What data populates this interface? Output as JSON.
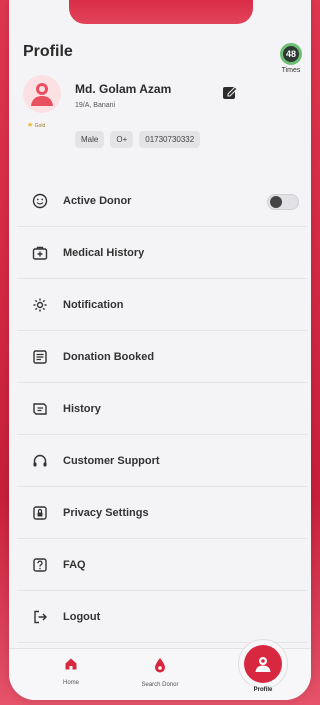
{
  "header": {
    "title": "Profile",
    "times_count": "48",
    "times_label": "Times"
  },
  "profile": {
    "name": "Md. Golam Azam",
    "address": "19/A, Banani",
    "badge": "Gold",
    "gender": "Male",
    "blood_group": "O+",
    "phone": "01730730332"
  },
  "menu": [
    {
      "label": "Active Donor",
      "icon": "smile-icon"
    },
    {
      "label": "Medical History",
      "icon": "medical-kit-icon"
    },
    {
      "label": "Notification",
      "icon": "gear-icon"
    },
    {
      "label": "Donation Booked",
      "icon": "calendar-icon"
    },
    {
      "label": "History",
      "icon": "history-icon"
    },
    {
      "label": "Customer Support",
      "icon": "support-icon"
    },
    {
      "label": "Privacy Settings",
      "icon": "privacy-icon"
    },
    {
      "label": "FAQ",
      "icon": "faq-icon"
    },
    {
      "label": "Logout",
      "icon": "logout-icon"
    }
  ],
  "active_donor_toggle": false,
  "bottom_nav": {
    "home": "Home",
    "search": "Search Donor",
    "profile": "Profile"
  },
  "colors": {
    "accent": "#d8283f",
    "background": "#f4f4f6"
  }
}
